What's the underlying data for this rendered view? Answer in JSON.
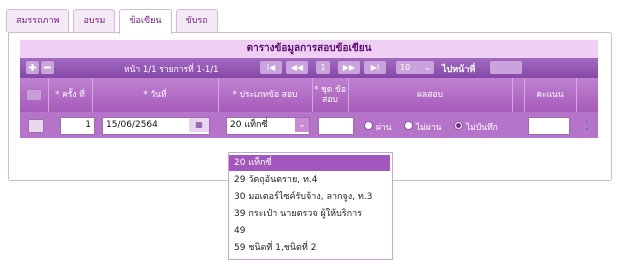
{
  "tabs": [
    {
      "label": "สมรรถภาพ",
      "active": false
    },
    {
      "label": "อบรม",
      "active": false
    },
    {
      "label": "ข้อเขียน",
      "active": true
    },
    {
      "label": "ขับรถ",
      "active": false
    }
  ],
  "table": {
    "title": "ตารางข้อมูลการสอบข้อเขียน",
    "pager": {
      "add_icon": "plus-icon",
      "remove_icon": "minus-icon",
      "info": "หน้า 1/1 รายการที่ 1-1/1",
      "first": "I◀",
      "prev": "◀◀",
      "current_page": "1",
      "next": "▶▶",
      "last": "▶I",
      "page_size": "10",
      "goto_label": "ไปหน้าที่",
      "goto_value": ""
    },
    "columns": [
      "* ครั้ง ที่",
      "* วันที่",
      "* ประเภทข้อ สอบ",
      "* ชุด ข้อ สอบ",
      "ผลสอบ",
      "คะแนน"
    ],
    "row": {
      "times": "1",
      "date": "15/06/2564",
      "exam_type": "20 แท็กซี่",
      "exam_set": "",
      "result_options": [
        "ผ่าน",
        "ไม่ผ่าน",
        "ไม่บันทึก"
      ],
      "result_selected": "ไม่บันทึก",
      "score": ""
    }
  },
  "dropdown": {
    "options": [
      "20 แท็กซี่",
      "29 วัตถุอันตราย, ท.4",
      "30 มอเตอร์ไซค์รับจ้าง, ลากจูง, ท.3",
      "39 กระเป๋า นายตรวจ ผู้ให้บริการ",
      "49",
      "59 ชนิดที่ 1,ชนิดที่ 2"
    ],
    "selected": "20 แท็กซี่"
  },
  "colors": {
    "accent": "#a356bd",
    "header": "#b574c9",
    "title_bg": "#efd0f4"
  }
}
